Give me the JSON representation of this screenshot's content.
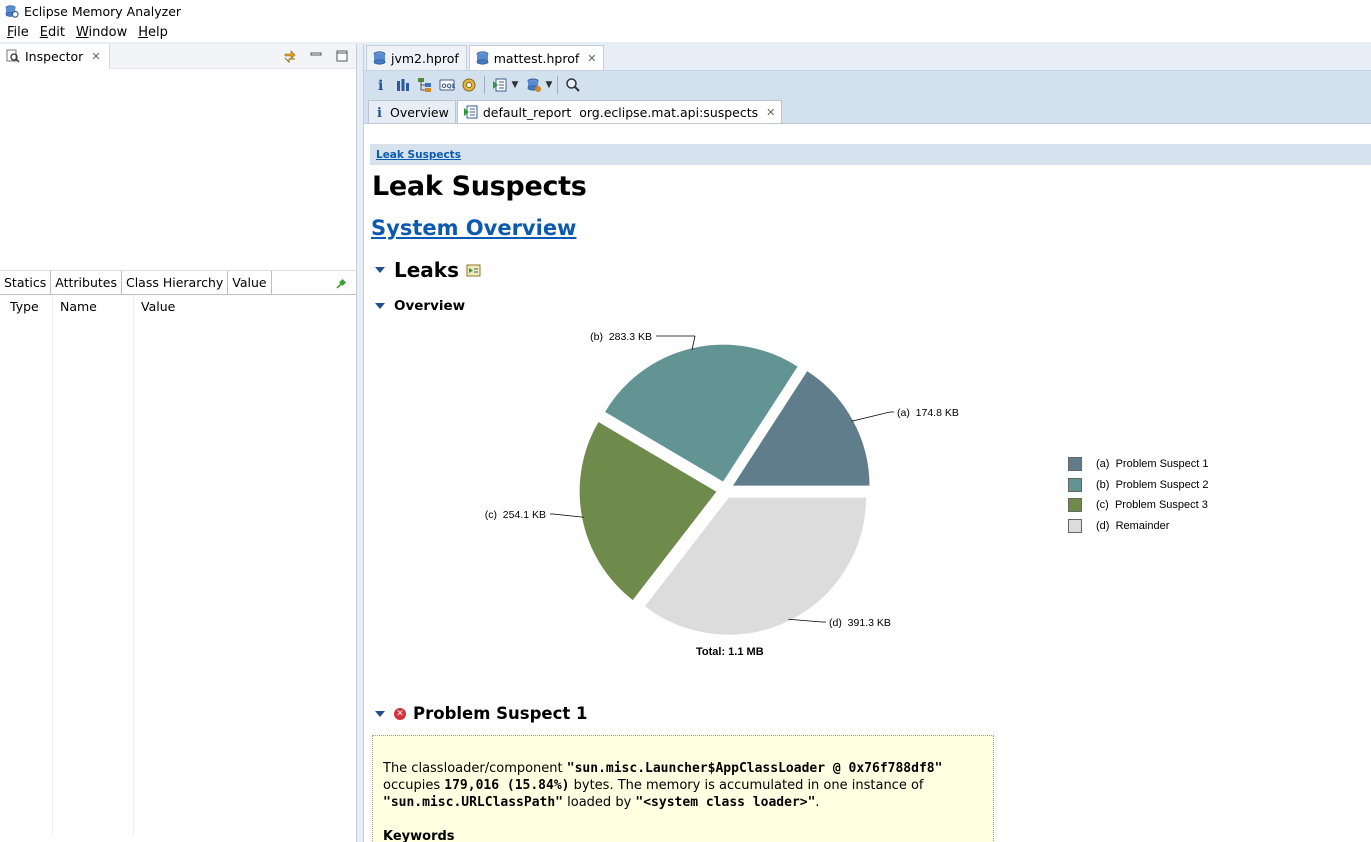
{
  "window": {
    "title": "Eclipse Memory Analyzer"
  },
  "menu": [
    {
      "label_u": "F",
      "label_rest": "ile"
    },
    {
      "label_u": "E",
      "label_rest": "dit"
    },
    {
      "label_u": "W",
      "label_rest": "indow"
    },
    {
      "label_u": "H",
      "label_rest": "elp"
    }
  ],
  "inspector": {
    "tab_label": "Inspector",
    "sub_tabs": [
      "Statics",
      "Attributes",
      "Class Hierarchy",
      "Value"
    ],
    "columns": [
      "Type",
      "Name",
      "Value"
    ]
  },
  "editor": {
    "tabs": [
      "jvm2.hprof",
      "mattest.hprof"
    ],
    "page_tabs": [
      "Overview",
      "default_report  org.eclipse.mat.api:suspects"
    ]
  },
  "report": {
    "breadcrumb": "Leak Suspects",
    "title": "Leak Suspects",
    "system_overview": "System Overview",
    "leaks_heading": "Leaks",
    "overview_heading": "Overview",
    "problem_heading": "Problem Suspect 1",
    "desc_1": "The classloader/component ",
    "desc_loader": "\"sun.misc.Launcher$AppClassLoader @ 0x76f788df8\"",
    "desc_2": "occupies ",
    "desc_bytes": "179,016 (15.84%)",
    "desc_3": " bytes. The memory is accumulated in one instance of",
    "desc_class": "\"sun.misc.URLClassPath\"",
    "desc_4": " loaded by ",
    "desc_loader2": "\"<system class loader>\"",
    "desc_5": ".",
    "keywords": "Keywords"
  },
  "chart_data": {
    "type": "pie",
    "total_label": "Total: 1.1 MB",
    "slices": [
      {
        "id": "(a)",
        "label": "(a)  174.8 KB",
        "legend": "Problem Suspect 1",
        "value": 174.8,
        "color": "#607d8b"
      },
      {
        "id": "(b)",
        "label": "(b)  283.3 KB",
        "legend": "Problem Suspect 2",
        "value": 283.3,
        "color": "#639494"
      },
      {
        "id": "(c)",
        "label": "(c)  254.1 KB",
        "legend": "Problem Suspect 3",
        "value": 254.1,
        "color": "#6e8b4c"
      },
      {
        "id": "(d)",
        "label": "(d)  391.3 KB",
        "legend": "Remainder",
        "value": 391.3,
        "color": "#dcdcdc"
      }
    ]
  }
}
